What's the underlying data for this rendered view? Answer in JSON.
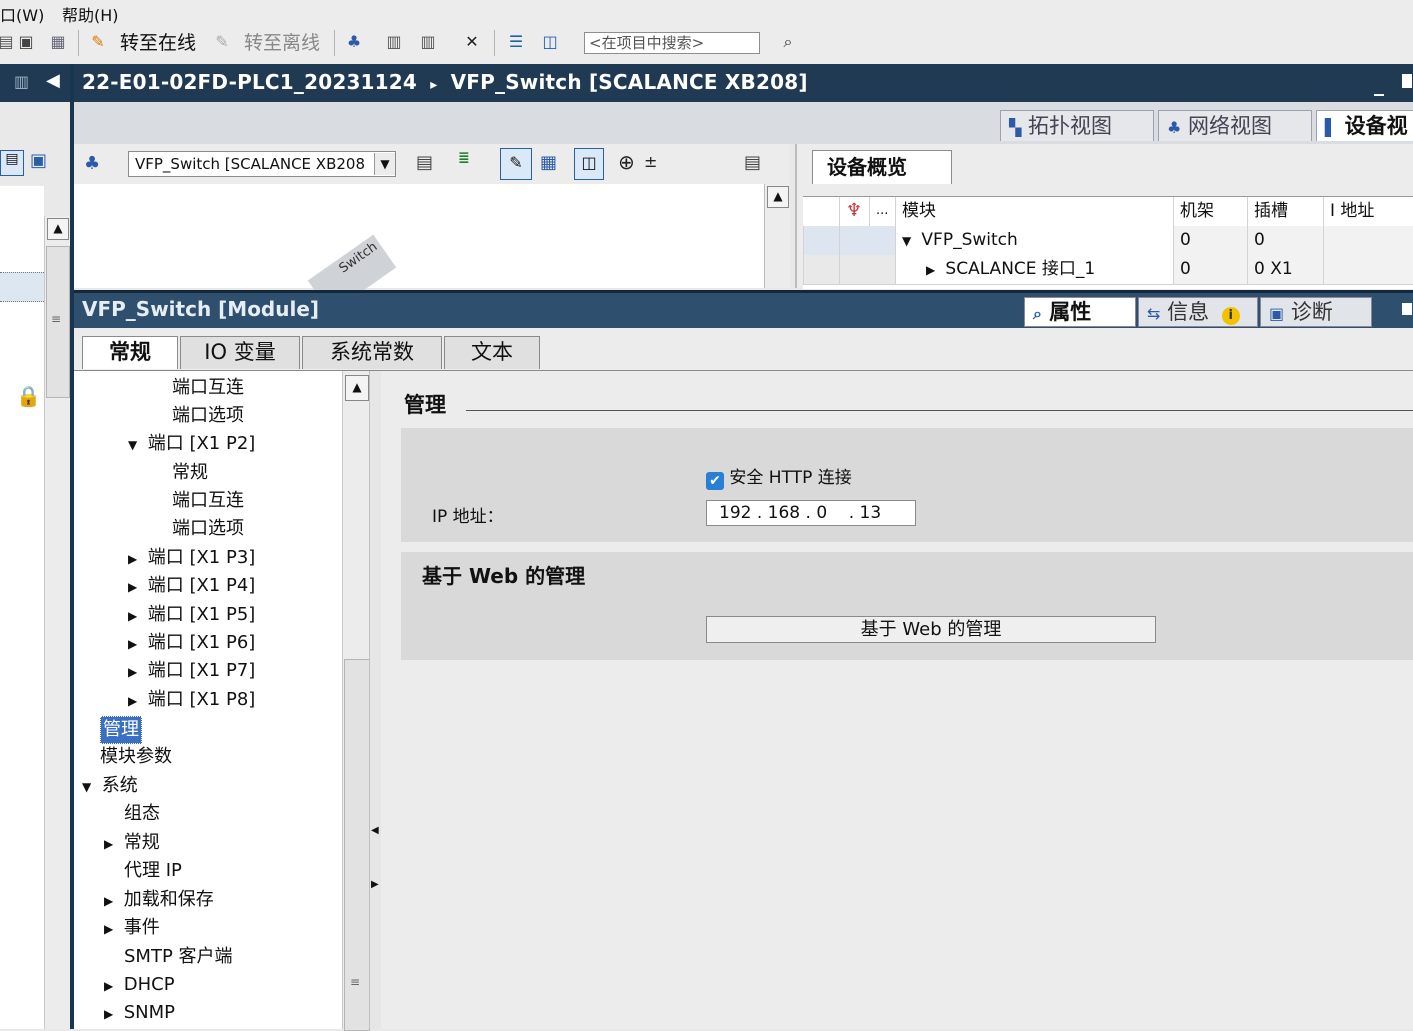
{
  "menu": {
    "window": "口(W)",
    "help": "帮助(H)"
  },
  "toolbar": {
    "go_online": "转至在线",
    "go_offline": "转至离线",
    "search_placeholder": "<在项目中搜索>"
  },
  "title": {
    "breadcrumb_project": "22-E01-02FD-PLC1_20231124",
    "breadcrumb_sep": "▸",
    "breadcrumb_device": "VFP_Switch [SCALANCE XB208]"
  },
  "view_tabs": [
    {
      "label": "拓扑视图",
      "icon": "topology-icon"
    },
    {
      "label": "网络视图",
      "icon": "network-icon"
    },
    {
      "label": "设备视",
      "icon": "device-icon"
    }
  ],
  "device_toolbar": {
    "selected_device": "VFP_Switch [SCALANCE XB208"
  },
  "canvas": {
    "device_label": "Switch"
  },
  "overview": {
    "tab": "设备概览",
    "columns": [
      "...",
      "模块",
      "机架",
      "插槽",
      "I 地址"
    ],
    "rows": [
      {
        "module": "VFP_Switch",
        "rack": "0",
        "slot": "0",
        "address": ""
      },
      {
        "module": "SCALANCE 接口_1",
        "rack": "0",
        "slot": "0 X1",
        "address": ""
      }
    ]
  },
  "properties": {
    "title": "VFP_Switch [Module]",
    "tabs": [
      "属性",
      "信息",
      "诊断"
    ]
  },
  "inspector_tabs": [
    "常规",
    "IO 变量",
    "系统常数",
    "文本"
  ],
  "tree": {
    "items": [
      {
        "label": "端口互连",
        "expander": ""
      },
      {
        "label": "端口选项",
        "expander": ""
      },
      {
        "label": "端口 [X1 P2]",
        "expander": "▼"
      },
      {
        "label": "常规",
        "expander": ""
      },
      {
        "label": "端口互连",
        "expander": ""
      },
      {
        "label": "端口选项",
        "expander": ""
      },
      {
        "label": "端口 [X1 P3]",
        "expander": "▶"
      },
      {
        "label": "端口 [X1 P4]",
        "expander": "▶"
      },
      {
        "label": "端口 [X1 P5]",
        "expander": "▶"
      },
      {
        "label": "端口 [X1 P6]",
        "expander": "▶"
      },
      {
        "label": "端口 [X1 P7]",
        "expander": "▶"
      },
      {
        "label": "端口 [X1 P8]",
        "expander": "▶"
      },
      {
        "label": "管理",
        "expander": ""
      },
      {
        "label": "模块参数",
        "expander": ""
      },
      {
        "label": "系统",
        "expander": "▼"
      },
      {
        "label": "组态",
        "expander": ""
      },
      {
        "label": "常规",
        "expander": "▶"
      },
      {
        "label": "代理 IP",
        "expander": ""
      },
      {
        "label": "加载和保存",
        "expander": "▶"
      },
      {
        "label": "事件",
        "expander": "▶"
      },
      {
        "label": "SMTP 客户端",
        "expander": ""
      },
      {
        "label": "DHCP",
        "expander": "▶"
      },
      {
        "label": "SNMP",
        "expander": "▶"
      }
    ]
  },
  "content": {
    "heading": "管理",
    "secure_http_label": "安全 HTTP 连接",
    "secure_http_checked": true,
    "ip_label": "IP 地址：",
    "ip_value": "192 . 168 . 0    . 13",
    "web_section_title": "基于 Web 的管理",
    "web_button": "基于 Web 的管理"
  }
}
